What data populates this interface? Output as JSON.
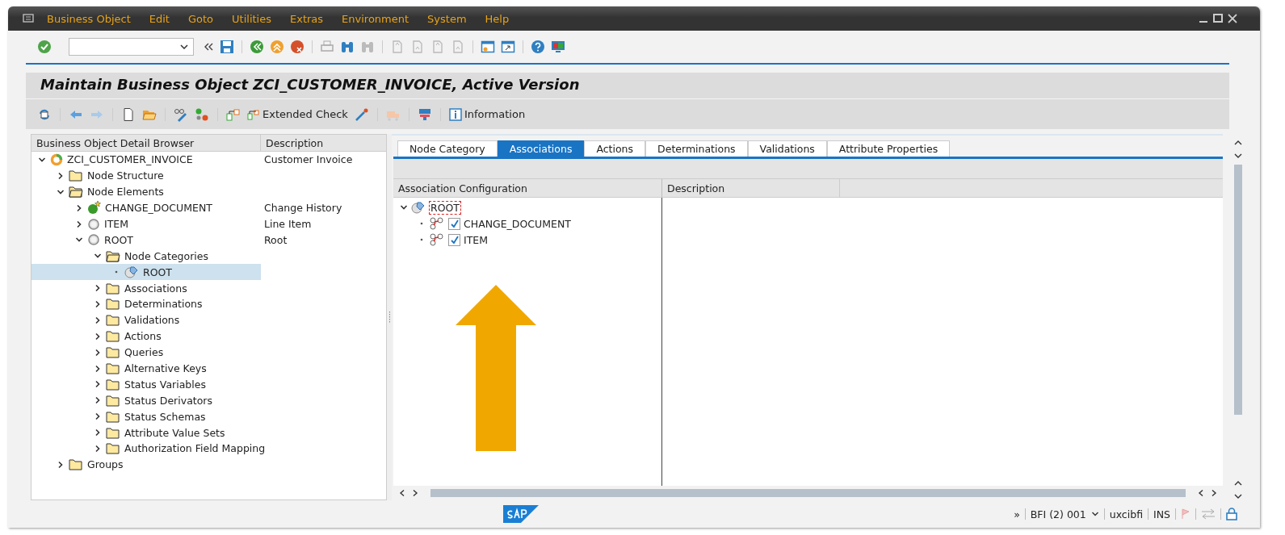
{
  "menu": [
    "Business Object",
    "Edit",
    "Goto",
    "Utilities",
    "Extras",
    "Environment",
    "System",
    "Help"
  ],
  "title": "Maintain Business Object ZCI_CUSTOMER_INVOICE, Active Version",
  "app_toolbar": [
    {
      "label": "Extended Check"
    },
    {
      "label": "Information"
    }
  ],
  "browser": {
    "columns": [
      "Business Object Detail Browser",
      "Description"
    ],
    "tree": [
      {
        "label": "ZCI_CUSTOMER_INVOICE",
        "description": "Customer Invoice",
        "kind": "bo",
        "expanded": true,
        "selected": false,
        "children": [
          {
            "label": "Node Structure",
            "kind": "folder",
            "expanded": false,
            "selected": false
          },
          {
            "label": "Node Elements",
            "kind": "folder",
            "expanded": true,
            "selected": false,
            "children": [
              {
                "label": "CHANGE_DOCUMENT",
                "description": "Change History",
                "kind": "special",
                "expanded": false,
                "selected": false
              },
              {
                "label": "ITEM",
                "description": "Line Item",
                "kind": "node",
                "expanded": false,
                "selected": false
              },
              {
                "label": "ROOT",
                "description": "Root",
                "kind": "node",
                "expanded": true,
                "selected": false,
                "children": [
                  {
                    "label": "Node Categories",
                    "kind": "folder",
                    "expanded": true,
                    "selected": false,
                    "children": [
                      {
                        "label": "ROOT",
                        "kind": "category",
                        "selected": true
                      }
                    ]
                  },
                  {
                    "label": "Associations",
                    "kind": "folder",
                    "expanded": false,
                    "selected": false
                  },
                  {
                    "label": "Determinations",
                    "kind": "folder",
                    "expanded": false,
                    "selected": false
                  },
                  {
                    "label": "Validations",
                    "kind": "folder",
                    "expanded": false,
                    "selected": false
                  },
                  {
                    "label": "Actions",
                    "kind": "folder",
                    "expanded": false,
                    "selected": false
                  },
                  {
                    "label": "Queries",
                    "kind": "folder",
                    "expanded": false,
                    "selected": false
                  },
                  {
                    "label": "Alternative Keys",
                    "kind": "folder",
                    "expanded": false,
                    "selected": false
                  },
                  {
                    "label": "Status Variables",
                    "kind": "folder",
                    "expanded": false,
                    "selected": false
                  },
                  {
                    "label": "Status Derivators",
                    "kind": "folder",
                    "expanded": false,
                    "selected": false
                  },
                  {
                    "label": "Status Schemas",
                    "kind": "folder",
                    "expanded": false,
                    "selected": false
                  },
                  {
                    "label": "Attribute Value Sets",
                    "kind": "folder",
                    "expanded": false,
                    "selected": false
                  },
                  {
                    "label": "Authorization Field Mapping",
                    "kind": "folder",
                    "expanded": false,
                    "selected": false
                  }
                ]
              }
            ]
          },
          {
            "label": "Groups",
            "kind": "folder",
            "expanded": false,
            "selected": false
          }
        ]
      }
    ]
  },
  "tabs": [
    {
      "label": "Node Category",
      "selected": false
    },
    {
      "label": "Associations",
      "selected": true
    },
    {
      "label": "Actions",
      "selected": false
    },
    {
      "label": "Determinations",
      "selected": false
    },
    {
      "label": "Validations",
      "selected": false
    },
    {
      "label": "Attribute Properties",
      "selected": false
    }
  ],
  "associations": {
    "columns": [
      "Association Configuration",
      "Description"
    ],
    "root": {
      "label": "ROOT",
      "expanded": true,
      "focused": true
    },
    "items": [
      {
        "label": "CHANGE_DOCUMENT",
        "checked": true
      },
      {
        "label": "ITEM",
        "checked": true
      }
    ]
  },
  "status_bar": {
    "expand": "»",
    "system": "BFI (2) 001",
    "user": "uxcibfi",
    "mode": "INS"
  }
}
